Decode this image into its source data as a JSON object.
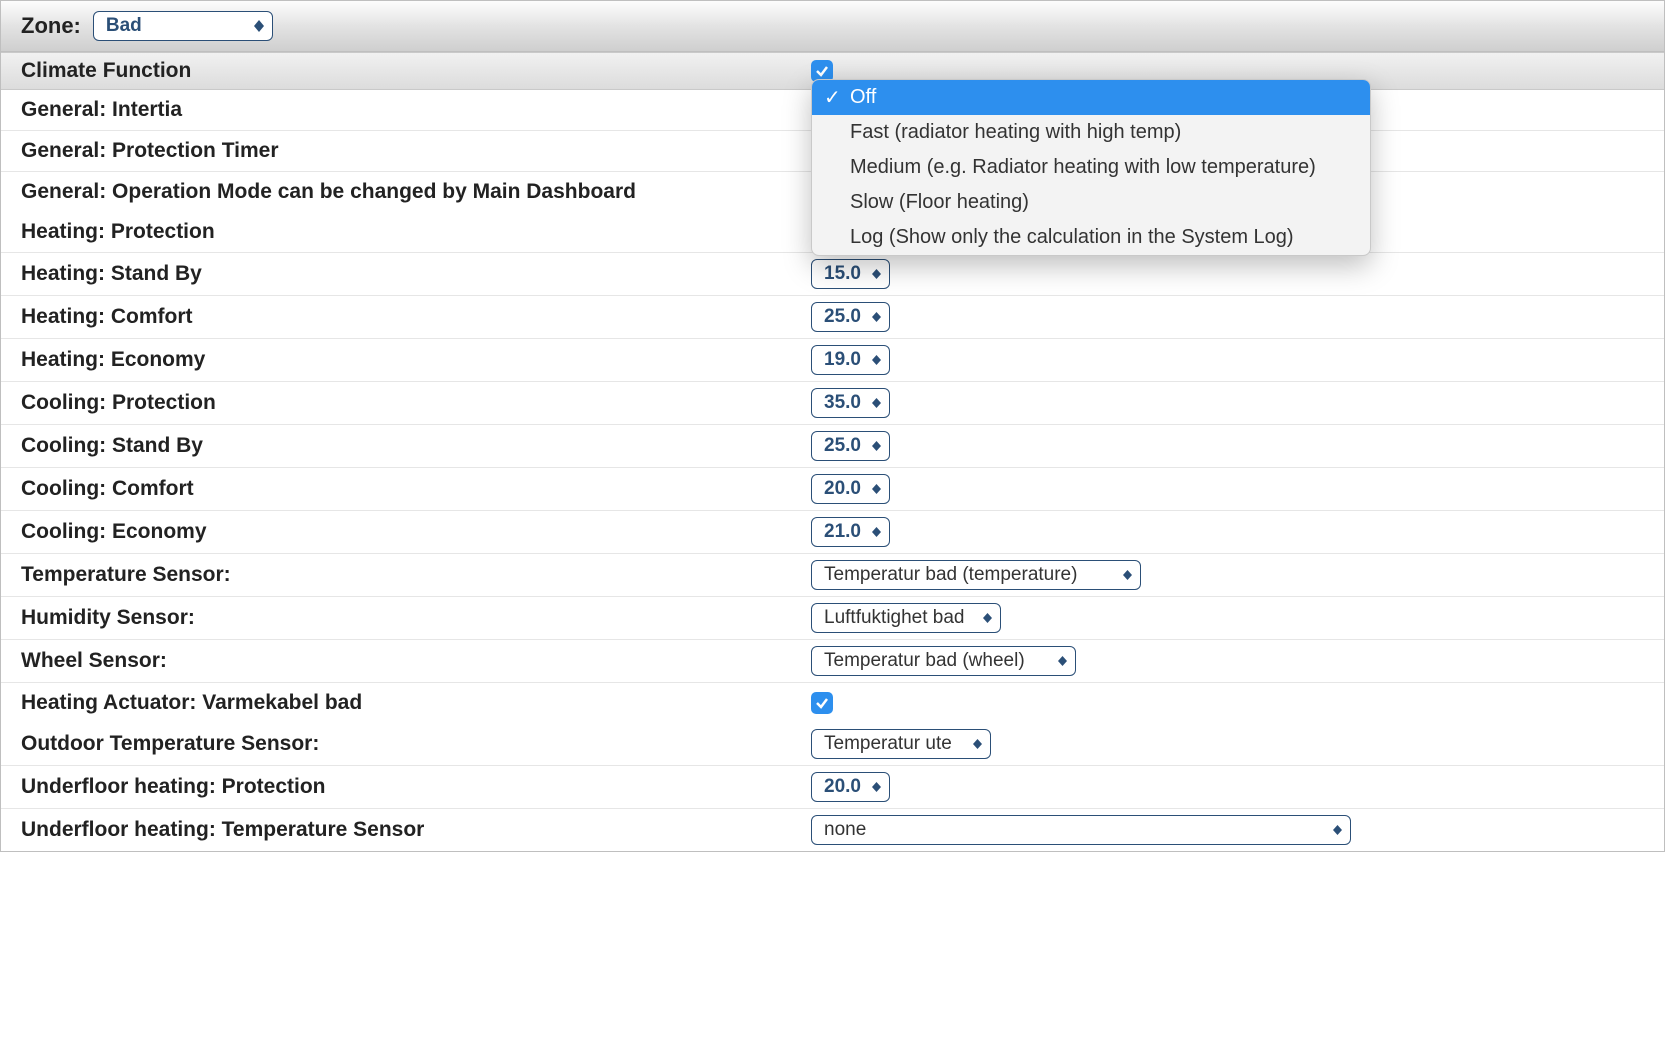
{
  "zone": {
    "label": "Zone:",
    "value": "Bad"
  },
  "section": {
    "climate_function": {
      "label": "Climate Function",
      "checked": true
    }
  },
  "rows": {
    "inertia": {
      "label": "General: Intertia"
    },
    "protection_timer": {
      "label": "General: Protection Timer"
    },
    "op_mode_dashboard": {
      "label": "General: Operation Mode can be changed by Main Dashboard"
    },
    "heating_protection": {
      "label": "Heating: Protection"
    },
    "heating_standby": {
      "label": "Heating: Stand By",
      "value": "15.0"
    },
    "heating_comfort": {
      "label": "Heating: Comfort",
      "value": "25.0"
    },
    "heating_economy": {
      "label": "Heating: Economy",
      "value": "19.0"
    },
    "cooling_protection": {
      "label": "Cooling: Protection",
      "value": "35.0"
    },
    "cooling_standby": {
      "label": "Cooling: Stand By",
      "value": "25.0"
    },
    "cooling_comfort": {
      "label": "Cooling: Comfort",
      "value": "20.0"
    },
    "cooling_economy": {
      "label": "Cooling: Economy",
      "value": "21.0"
    },
    "temperature_sensor": {
      "label": "Temperature Sensor:",
      "value": "Temperatur bad (temperature)"
    },
    "humidity_sensor": {
      "label": "Humidity Sensor:",
      "value": "Luftfuktighet bad"
    },
    "wheel_sensor": {
      "label": "Wheel Sensor:",
      "value": "Temperatur bad (wheel)"
    },
    "heating_actuator": {
      "label": "Heating Actuator: Varmekabel bad",
      "checked": true
    },
    "outdoor_temp_sensor": {
      "label": "Outdoor Temperature Sensor:",
      "value": "Temperatur ute"
    },
    "underfloor_protection": {
      "label": "Underfloor heating: Protection",
      "value": "20.0"
    },
    "underfloor_temp_sensor": {
      "label": "Underfloor heating: Temperature Sensor",
      "value": "none"
    }
  },
  "inertia_options": {
    "selected": "Off",
    "items": [
      "Off",
      "Fast (radiator heating with high temp)",
      "Medium (e.g. Radiator heating with low temperature)",
      "Slow (Floor heating)",
      "Log (Show only the calculation in the System Log)"
    ]
  }
}
